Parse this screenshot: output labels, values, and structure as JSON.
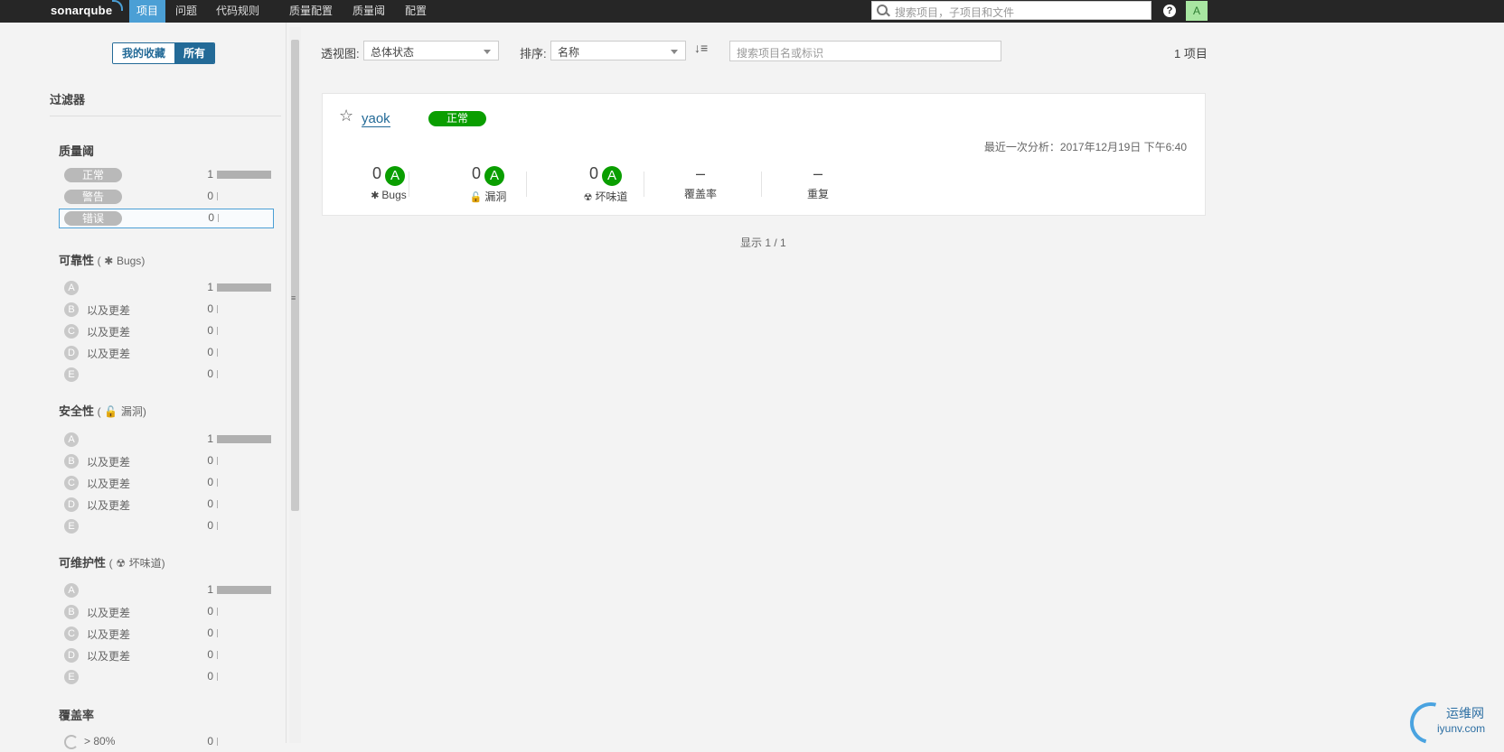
{
  "nav": {
    "logo": "sonarqube",
    "items": [
      "项目",
      "问题",
      "代码规则",
      "质量配置",
      "质量阈",
      "配置"
    ],
    "search_placeholder": "搜索项目，子项目和文件",
    "help": "?",
    "avatar": "A"
  },
  "sidebar": {
    "toggle_fav": "我的收藏",
    "toggle_all": "所有",
    "filters_title": "过滤器",
    "quality_gate": {
      "title": "质量阈",
      "rows": [
        {
          "label": "正常",
          "count": "1",
          "bar": 1.0
        },
        {
          "label": "警告",
          "count": "0",
          "bar": 0
        },
        {
          "label": "错误",
          "count": "0",
          "bar": 0
        }
      ]
    },
    "reliability": {
      "title": "可靠性",
      "paren_open": "(",
      "sub": "Bugs",
      "paren_close": ")",
      "icon": "bug-icon",
      "rows": [
        {
          "grade": "A",
          "label": "",
          "count": "1",
          "bar": 1.0
        },
        {
          "grade": "B",
          "label": "以及更差",
          "count": "0",
          "bar": 0
        },
        {
          "grade": "C",
          "label": "以及更差",
          "count": "0",
          "bar": 0
        },
        {
          "grade": "D",
          "label": "以及更差",
          "count": "0",
          "bar": 0
        },
        {
          "grade": "E",
          "label": "",
          "count": "0",
          "bar": 0
        }
      ]
    },
    "security": {
      "title": "安全性",
      "paren_open": "(",
      "sub": "漏洞",
      "paren_close": ")",
      "icon": "lock-icon",
      "rows": [
        {
          "grade": "A",
          "label": "",
          "count": "1",
          "bar": 1.0
        },
        {
          "grade": "B",
          "label": "以及更差",
          "count": "0",
          "bar": 0
        },
        {
          "grade": "C",
          "label": "以及更差",
          "count": "0",
          "bar": 0
        },
        {
          "grade": "D",
          "label": "以及更差",
          "count": "0",
          "bar": 0
        },
        {
          "grade": "E",
          "label": "",
          "count": "0",
          "bar": 0
        }
      ]
    },
    "maintainability": {
      "title": "可维护性",
      "paren_open": "(",
      "sub": "坏味道",
      "paren_close": ")",
      "icon": "code-smell-icon",
      "rows": [
        {
          "grade": "A",
          "label": "",
          "count": "1",
          "bar": 1.0
        },
        {
          "grade": "B",
          "label": "以及更差",
          "count": "0",
          "bar": 0
        },
        {
          "grade": "C",
          "label": "以及更差",
          "count": "0",
          "bar": 0
        },
        {
          "grade": "D",
          "label": "以及更差",
          "count": "0",
          "bar": 0
        },
        {
          "grade": "E",
          "label": "",
          "count": "0",
          "bar": 0
        }
      ]
    },
    "coverage": {
      "title": "覆盖率",
      "rows": [
        {
          "label": "> 80%",
          "count": "0"
        }
      ]
    }
  },
  "toolbar": {
    "perspective_label": "透视图:",
    "perspective_value": "总体状态",
    "sort_label": "排序:",
    "sort_value": "名称",
    "search_placeholder": "搜索项目名或标识",
    "total": "1 项目"
  },
  "project": {
    "name": "yaok",
    "status": "正常",
    "analysis": "最近一次分析：2017年12月19日 下午6:40",
    "metrics": {
      "bugs": {
        "value": "0",
        "rating": "A",
        "label": "Bugs"
      },
      "vulnerabilities": {
        "value": "0",
        "rating": "A",
        "label": "漏洞"
      },
      "code_smells": {
        "value": "0",
        "rating": "A",
        "label": "坏味道"
      },
      "coverage": {
        "value": "–",
        "label": "覆盖率"
      },
      "duplications": {
        "value": "–",
        "label": "重复"
      }
    }
  },
  "paging": "显示 1 / 1",
  "watermark": {
    "t1": "运维网",
    "t2": "iyunv.com"
  },
  "colors": {
    "nav_bg": "#262626",
    "active": "#4b9fd5",
    "ok": "#0a9e00",
    "link": "#236a97"
  }
}
